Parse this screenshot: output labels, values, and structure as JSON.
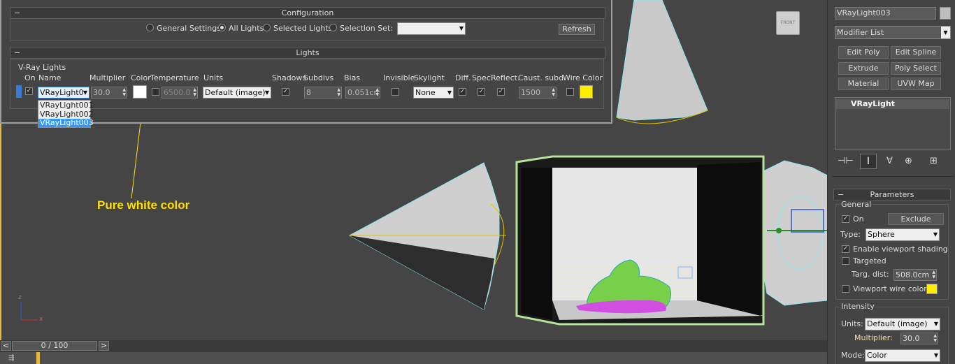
{
  "lister": {
    "config_title": "Configuration",
    "lights_title": "Lights",
    "collapse_symbol": "−",
    "radio_general": "General Settings",
    "radio_all": "All Lights",
    "radio_selected": "Selected Lights",
    "radio_selection_set": "Selection Set:",
    "refresh": "Refresh",
    "group_label": "V-Ray Lights",
    "headers": {
      "on": "On",
      "name": "Name",
      "multiplier": "Multiplier",
      "color": "Color",
      "temperature": "Temperature",
      "units": "Units",
      "shadows": "Shadows",
      "subdivs": "Subdivs",
      "bias": "Bias",
      "invisible": "Invisible",
      "skylight": "Skylight",
      "diff": "Diff.",
      "spec": "Spec.",
      "reflect": "Reflect.",
      "caust": "Caust. subd.",
      "wire": "Wire Color"
    },
    "row": {
      "name": "VRayLight0",
      "multiplier": "30.0",
      "temperature": "6500.0",
      "units": "Default (image)",
      "subdivs": "8",
      "bias": "0.051cm",
      "skylight": "None",
      "caust": "1500",
      "wire_color": "#ffee00"
    },
    "name_options": [
      "VRayLight001",
      "VRayLight002",
      "VRayLight003"
    ]
  },
  "viewport": {
    "annotation": "Pure white color",
    "viewcube_label": "FRONT",
    "axis_z": "z",
    "axis_x": "x"
  },
  "cmd": {
    "object_name": "VRayLight003",
    "modifier_list": "Modifier List",
    "mod_buttons": [
      "Edit Poly",
      "Edit Spline",
      "Extrude",
      "Poly Select",
      "Material",
      "UVW Map"
    ],
    "stack_item": "VRayLight",
    "parameters_title": "Parameters",
    "general_title": "General",
    "on_label": "On",
    "exclude": "Exclude",
    "type_label": "Type:",
    "type_value": "Sphere",
    "enable_vp_shading": "Enable viewport shading",
    "targeted": "Targeted",
    "targ_dist_label": "Targ. dist:",
    "targ_dist_value": "508.0cm",
    "vp_wire_color": "Viewport wire color",
    "intensity_title": "Intensity",
    "units_label": "Units:",
    "units_value": "Default (image)",
    "multiplier_label": "Multiplier:",
    "multiplier_value": "30.0",
    "mode_label": "Mode:",
    "mode_value": "Color",
    "wire_swatch": "#ffee00"
  },
  "timeline": {
    "frame": "0 / 100",
    "prev": "<",
    "next": ">"
  }
}
